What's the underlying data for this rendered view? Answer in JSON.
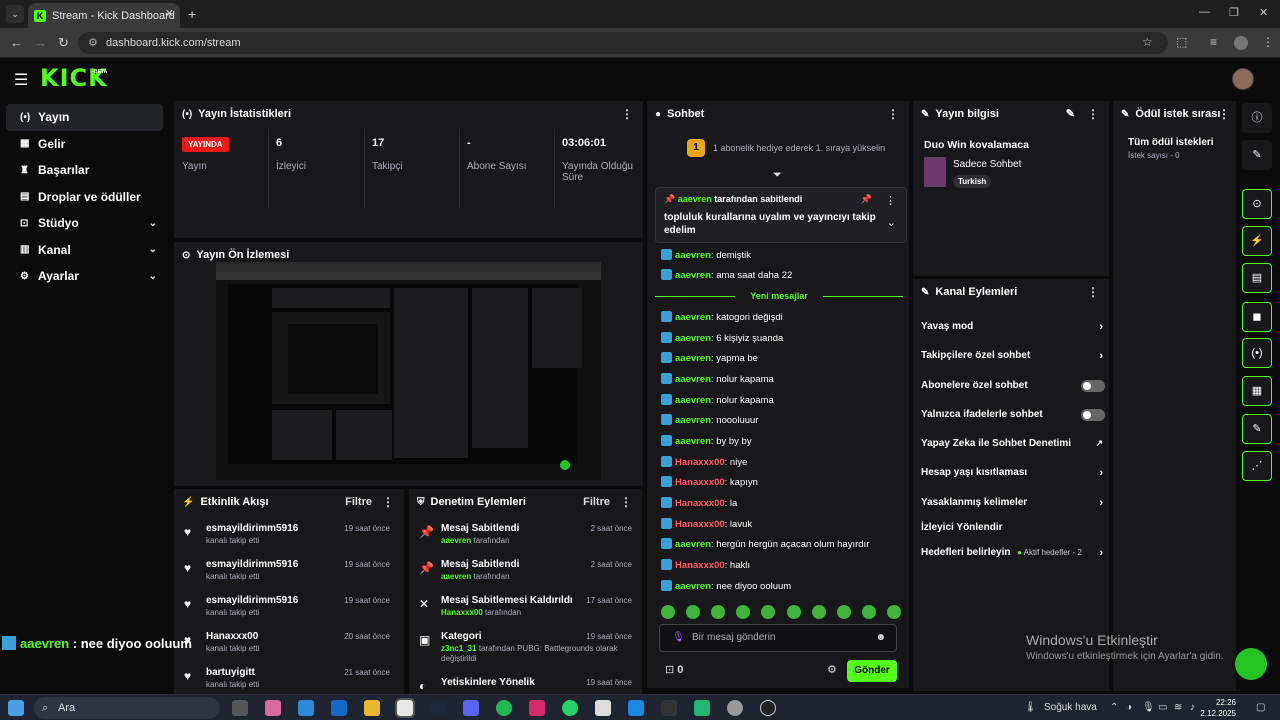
{
  "browser": {
    "tab_title": "Stream - Kick Dashboard",
    "url": "dashboard.kick.com/stream"
  },
  "brand": {
    "logo": "KICK",
    "beta": "BETA"
  },
  "sidebar": {
    "items": [
      {
        "label": "Yayın",
        "icon": "broadcast-icon",
        "active": true
      },
      {
        "label": "Gelir",
        "icon": "revenue-icon"
      },
      {
        "label": "Başarılar",
        "icon": "trophy-icon"
      },
      {
        "label": "Droplar ve ödüller",
        "icon": "gift-icon"
      },
      {
        "label": "Stüdyo",
        "icon": "studio-icon",
        "expand": true
      },
      {
        "label": "Kanal",
        "icon": "channel-icon",
        "expand": true
      },
      {
        "label": "Ayarlar",
        "icon": "gear-icon",
        "expand": true
      }
    ]
  },
  "stats": {
    "title": "Yayın İstatistikleri",
    "live_label": "YAYINDA",
    "items": [
      {
        "value": "",
        "label": "Yayın"
      },
      {
        "value": "6",
        "label": "İzleyici"
      },
      {
        "value": "17",
        "label": "Takipçi"
      },
      {
        "value": "-",
        "label": "Abone Sayısı"
      },
      {
        "value": "03:06:01",
        "label": "Yayında Olduğu Süre"
      }
    ]
  },
  "preview": {
    "title": "Yayın Ön İzlemesi"
  },
  "activity": {
    "title": "Etkinlik Akışı",
    "filter": "Filtre",
    "items": [
      {
        "name": "esmayildirimm5916",
        "sub": "kanalı takip etti",
        "time": "19 saat önce"
      },
      {
        "name": "esmayildirimm5916",
        "sub": "kanalı takip etti",
        "time": "19 saat önce"
      },
      {
        "name": "esmayildirimm5916",
        "sub": "kanalı takip etti",
        "time": "19 saat önce"
      },
      {
        "name": "Hanaxxx00",
        "sub": "kanalı takip etti",
        "time": "20 saat önce"
      },
      {
        "name": "bartuyigitt",
        "sub": "kanalı takip etti",
        "time": "21 saat önce"
      }
    ]
  },
  "moderation": {
    "title": "Denetim Eylemleri",
    "filter": "Filtre",
    "items": [
      {
        "name": "Mesaj Sabitlendi",
        "user": "aaevren",
        "sub": "tarafından",
        "time": "2 saat önce",
        "icon": "pin-icon"
      },
      {
        "name": "Mesaj Sabitlendi",
        "user": "aaevren",
        "sub": "tarafından",
        "time": "2 saat önce",
        "icon": "pin-icon"
      },
      {
        "name": "Mesaj Sabitlemesi Kaldırıldı",
        "user": "Hanaxxx00",
        "sub": "tarafından",
        "time": "17 saat önce",
        "icon": "unpin-icon"
      },
      {
        "name": "Kategori",
        "user": "z3nc1_31",
        "sub": "tarafından PUBG: Battlegrounds olarak değiştirildi",
        "time": "19 saat önce",
        "icon": "category-icon"
      },
      {
        "name": "Yetiskinlere Yönelik",
        "user": "",
        "sub": "",
        "time": "19 saat önce",
        "icon": "adult-icon"
      }
    ]
  },
  "chat": {
    "title": "Sohbet",
    "gift_rank": "1",
    "gift_text": "1 abonelik hediye ederek 1. sıraya yükselin",
    "pinned_by": "aaevren",
    "pinned_suffix": "tarafından sabitlendi",
    "pinned_msg": "topluluk kurallarına uyalım ve yayıncıyı takip edelim",
    "new_messages": "Yeni mesajlar",
    "messages": [
      {
        "user": "aaevren",
        "text": ": demiştik",
        "color": "green"
      },
      {
        "user": "aaevren",
        "text": ": ama saat daha 22",
        "color": "green"
      },
      {
        "user": "aaevren",
        "text": ": katogori değişdi",
        "color": "green"
      },
      {
        "user": "aaevren",
        "text": ": 6 kişiyiz şuanda",
        "color": "green"
      },
      {
        "user": "aaevren",
        "text": ": yapma be",
        "color": "green"
      },
      {
        "user": "aaevren",
        "text": ": nolur kapama",
        "color": "green"
      },
      {
        "user": "aaevren",
        "text": ": nolur kapama",
        "color": "green"
      },
      {
        "user": "aaevren",
        "text": ": noooluuur",
        "color": "green"
      },
      {
        "user": "aaevren",
        "text": ": by by by",
        "color": "green"
      },
      {
        "user": "Hanaxxx00",
        "text": ": niye",
        "color": "red"
      },
      {
        "user": "Hanaxxx00",
        "text": ": kapıyn",
        "color": "red"
      },
      {
        "user": "Hanaxxx00",
        "text": ": la",
        "color": "red"
      },
      {
        "user": "Hanaxxx00",
        "text": ": lavuk",
        "color": "red"
      },
      {
        "user": "aaevren",
        "text": ": hergün hergün açacan olum hayırdır",
        "color": "green"
      },
      {
        "user": "Hanaxxx00",
        "text": ": haklı",
        "color": "red"
      },
      {
        "user": "aaevren",
        "text": ": nee diyoo ooluum",
        "color": "green"
      }
    ],
    "placeholder": "Bir mesaj gönderin",
    "points": "0",
    "send": "Gönder"
  },
  "stream_info": {
    "title": "Yayın bilgisi",
    "stream_title": "Duo Win kovalamaca",
    "category": "Sadece Sohbet",
    "tag": "Turkish"
  },
  "channel_actions": {
    "title": "Kanal Eylemleri",
    "items": [
      {
        "label": "Yavaş mod",
        "control": "arrow"
      },
      {
        "label": "Takipçilere özel sohbet",
        "control": "arrow"
      },
      {
        "label": "Abonelere özel sohbet",
        "control": "toggle"
      },
      {
        "label": "Yalnızca ifadelerle sohbet",
        "control": "toggle"
      },
      {
        "label": "Yapay Zeka ile Sohbet Denetimi",
        "control": "external"
      },
      {
        "label": "Hesap yaşı kısıtlaması",
        "control": "arrow"
      },
      {
        "label": "Yasaklanmış kelimeler",
        "control": "arrow"
      },
      {
        "label": "İzleyici Yönlendir",
        "control": "none"
      },
      {
        "label": "Hedefleri belirleyin",
        "control": "arrow",
        "extra": "Aktif hedefler - 2"
      }
    ]
  },
  "rewards": {
    "title": "Ödül istek sırası",
    "all": "Tüm ödül istekleri",
    "count": "İstek sayısı - 0"
  },
  "overlay": {
    "user": "aaevren",
    "text": " : nee diyoo ooluum"
  },
  "watermark": {
    "line1": "Windows'u Etkinleştir",
    "line2": "Windows'u etkinleştirmek için Ayarlar'a gidin."
  },
  "taskbar": {
    "search": "Ara",
    "weather": "Soğuk hava",
    "time": "22:26",
    "date": "2.12.2025"
  }
}
